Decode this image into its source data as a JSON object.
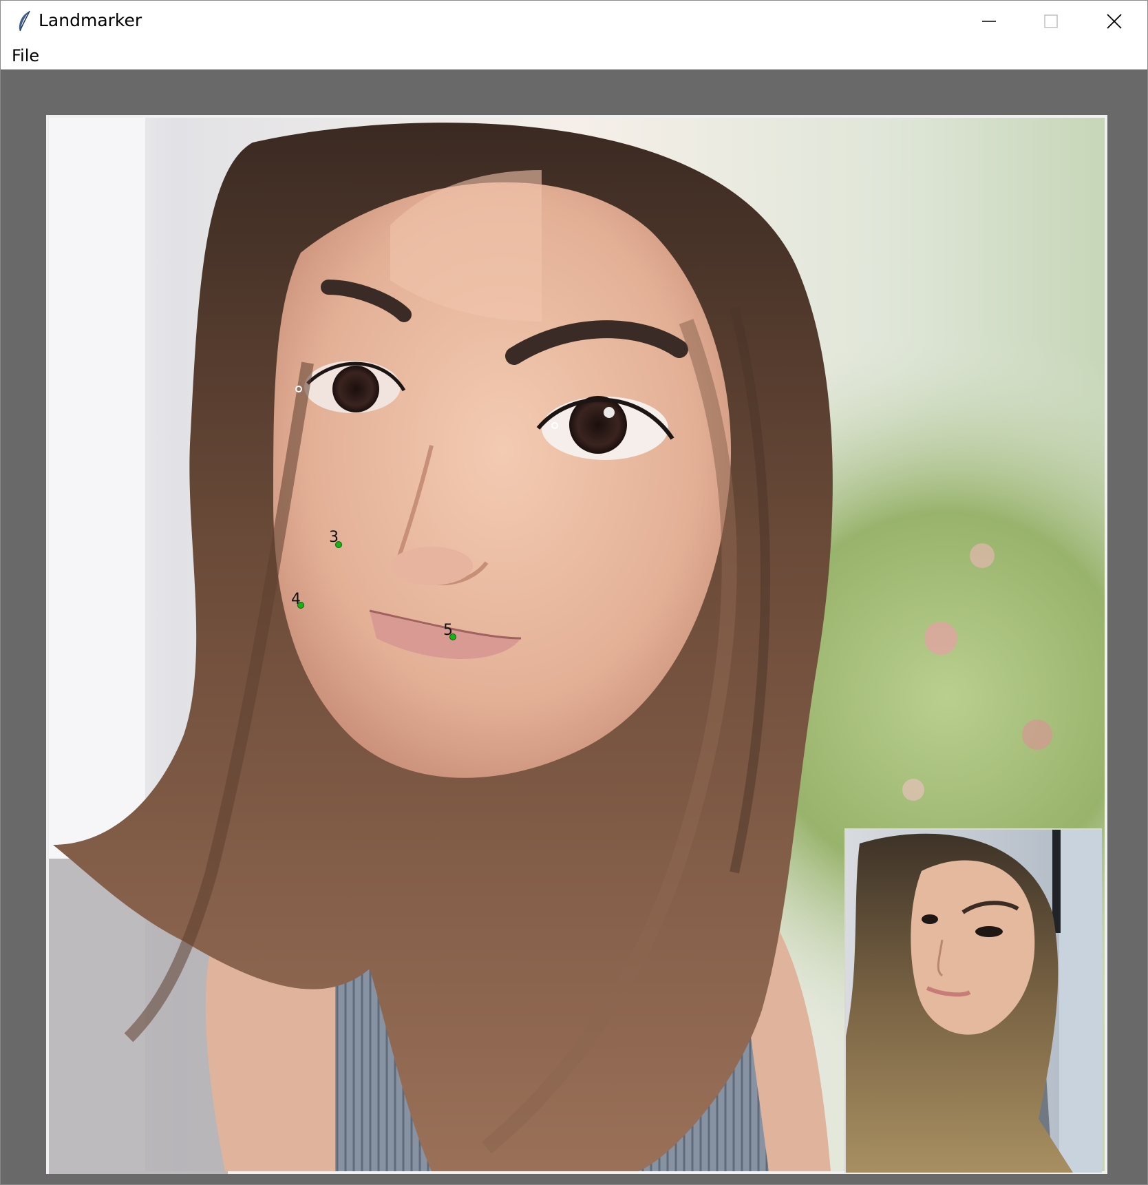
{
  "window": {
    "title": "Landmarker",
    "app_icon": "feather-icon",
    "controls": [
      "minimize-icon",
      "maximize-icon",
      "close-icon"
    ]
  },
  "menu": {
    "items": [
      {
        "label": "File"
      }
    ]
  },
  "landmarks": [
    {
      "label": "",
      "style": "open"
    },
    {
      "label": "",
      "style": "open"
    },
    {
      "label": "3",
      "style": "filled"
    },
    {
      "label": "4",
      "style": "filled"
    },
    {
      "label": "5",
      "style": "filled"
    }
  ],
  "colors": {
    "canvas_bg": "#696969",
    "landmark_fill": "#16b316",
    "landmark_open": "#ffffff"
  }
}
